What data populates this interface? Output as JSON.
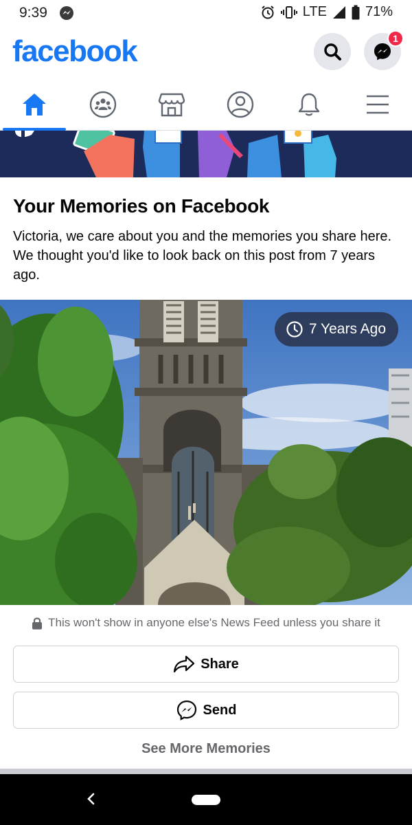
{
  "status_bar": {
    "time": "9:39",
    "network": "LTE",
    "battery": "71%"
  },
  "header": {
    "logo": "facebook",
    "messenger_badge": "1"
  },
  "tabs": [
    {
      "name": "home-icon",
      "active": true
    },
    {
      "name": "groups-icon",
      "active": false
    },
    {
      "name": "marketplace-icon",
      "active": false
    },
    {
      "name": "profile-icon",
      "active": false
    },
    {
      "name": "bell-icon",
      "active": false
    },
    {
      "name": "menu-icon",
      "active": false
    }
  ],
  "memory": {
    "title": "Your Memories on Facebook",
    "description": "Victoria, we care about you and the memories you share here. We thought you'd like to look back on this post from 7 years ago.",
    "chip": "7 Years Ago",
    "privacy_note": "This won't show in anyone else's News Feed unless you share it",
    "share_label": "Share",
    "send_label": "Send",
    "see_more_label": "See More Memories"
  },
  "colors": {
    "brand": "#1877f2",
    "badge": "#f02849",
    "secondary_text": "#65676b"
  }
}
